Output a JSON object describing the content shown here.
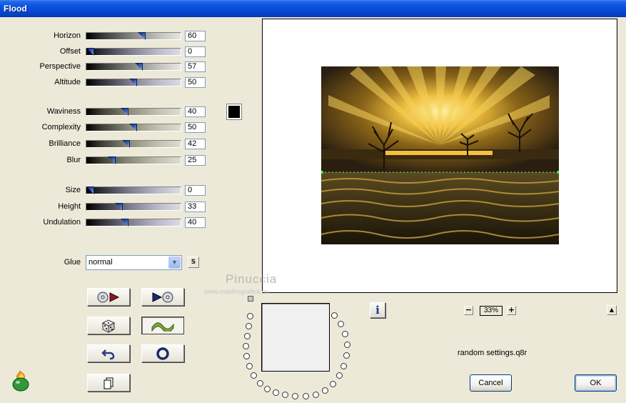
{
  "window": {
    "title": "Flood"
  },
  "sliders": [
    {
      "label": "Horizon",
      "value": "60",
      "level": 60
    },
    {
      "label": "Offset",
      "value": "0",
      "level": 0
    },
    {
      "label": "Perspective",
      "value": "57",
      "level": 57
    },
    {
      "label": "Altitude",
      "value": "50",
      "level": 50
    },
    {
      "label": "Waviness",
      "value": "40",
      "level": 40
    },
    {
      "label": "Complexity",
      "value": "50",
      "level": 50
    },
    {
      "label": "Brilliance",
      "value": "42",
      "level": 42
    },
    {
      "label": "Blur",
      "value": "25",
      "level": 25
    },
    {
      "label": "Size",
      "value": "0",
      "level": 0
    },
    {
      "label": "Height",
      "value": "33",
      "level": 33
    },
    {
      "label": "Undulation",
      "value": "40",
      "level": 40
    }
  ],
  "color_swatch": "#000000",
  "glue": {
    "label": "Glue",
    "value": "normal",
    "s_button": "S"
  },
  "watermark": {
    "name": "Pinuccia",
    "url": "www.maidiregrafica.eu"
  },
  "zoom": {
    "value": "33%",
    "minus": "−",
    "plus": "+"
  },
  "info_label": "i",
  "settings_file": "random settings.q8r",
  "buttons": {
    "cancel": "Cancel",
    "ok": "OK"
  },
  "colors": {
    "titlebar": "#0a55e3",
    "dialog_bg": "#ece9d8",
    "slider_thumb": "#2f5bb8"
  },
  "icons": {
    "load_preset": "disc-arrow-icon",
    "save_preset": "arrow-disc-icon",
    "randomize": "dice-icon",
    "preview_wave": "wave-icon",
    "undo": "undo-arrow-icon",
    "reset": "ring-icon",
    "copy": "copy-document-icon",
    "logo": "flaming-pot-logo"
  }
}
